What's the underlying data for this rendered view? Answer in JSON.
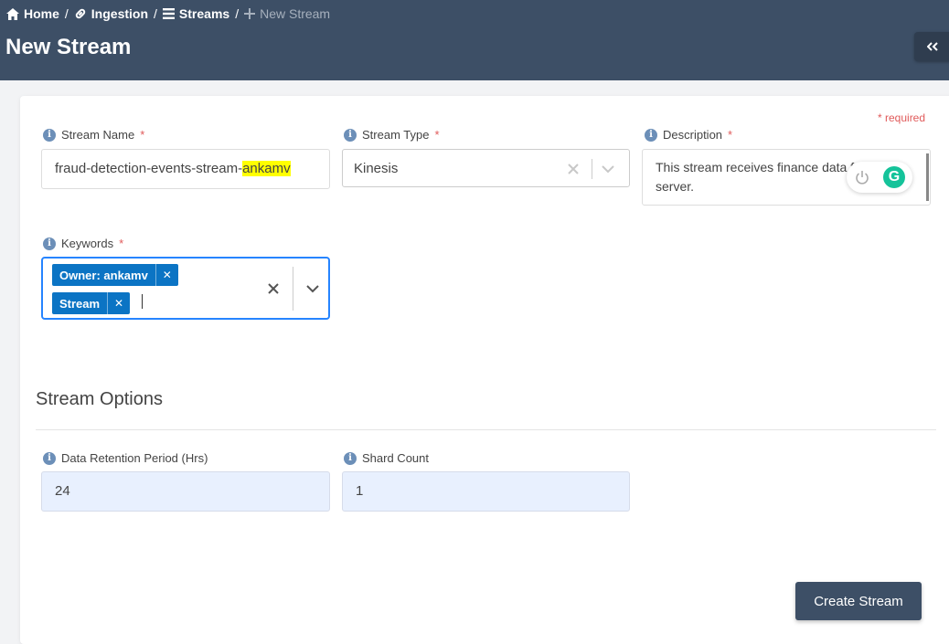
{
  "breadcrumb": {
    "home": "Home",
    "ingestion": "Ingestion",
    "streams": "Streams",
    "current": "New Stream",
    "separator": "/"
  },
  "page_title": "New Stream",
  "required_note": "* required",
  "form": {
    "stream_name": {
      "label": "Stream Name",
      "value_prefix": "fraud-detection-events-stream-",
      "value_highlight": "ankamv"
    },
    "stream_type": {
      "label": "Stream Type",
      "value": "Kinesis"
    },
    "description": {
      "label": "Description",
      "value": "This stream receives finance data from server."
    },
    "keywords": {
      "label": "Keywords",
      "tags": [
        "Owner: ankamv",
        "Stream"
      ]
    },
    "required_marker": "*"
  },
  "stream_options": {
    "title": "Stream Options",
    "retention": {
      "label": "Data Retention Period (Hrs)",
      "value": "24"
    },
    "shard_count": {
      "label": "Shard Count",
      "value": "1"
    }
  },
  "create_button": "Create Stream",
  "grammarly_logo": "G",
  "colors": {
    "header": "#3d4f66",
    "tag": "#0b74c4",
    "focus_border": "#2684ff",
    "required": "#e05a5a",
    "highlight": "#ffff00",
    "grammarly": "#15c39a"
  },
  "icons": {
    "home": "home-icon",
    "ingestion": "link-icon",
    "streams": "list-icon",
    "new_stream": "plus-icon",
    "collapse": "double-chevron-left-icon",
    "info": "info-icon",
    "clear": "close-icon",
    "dropdown": "chevron-down-icon"
  }
}
